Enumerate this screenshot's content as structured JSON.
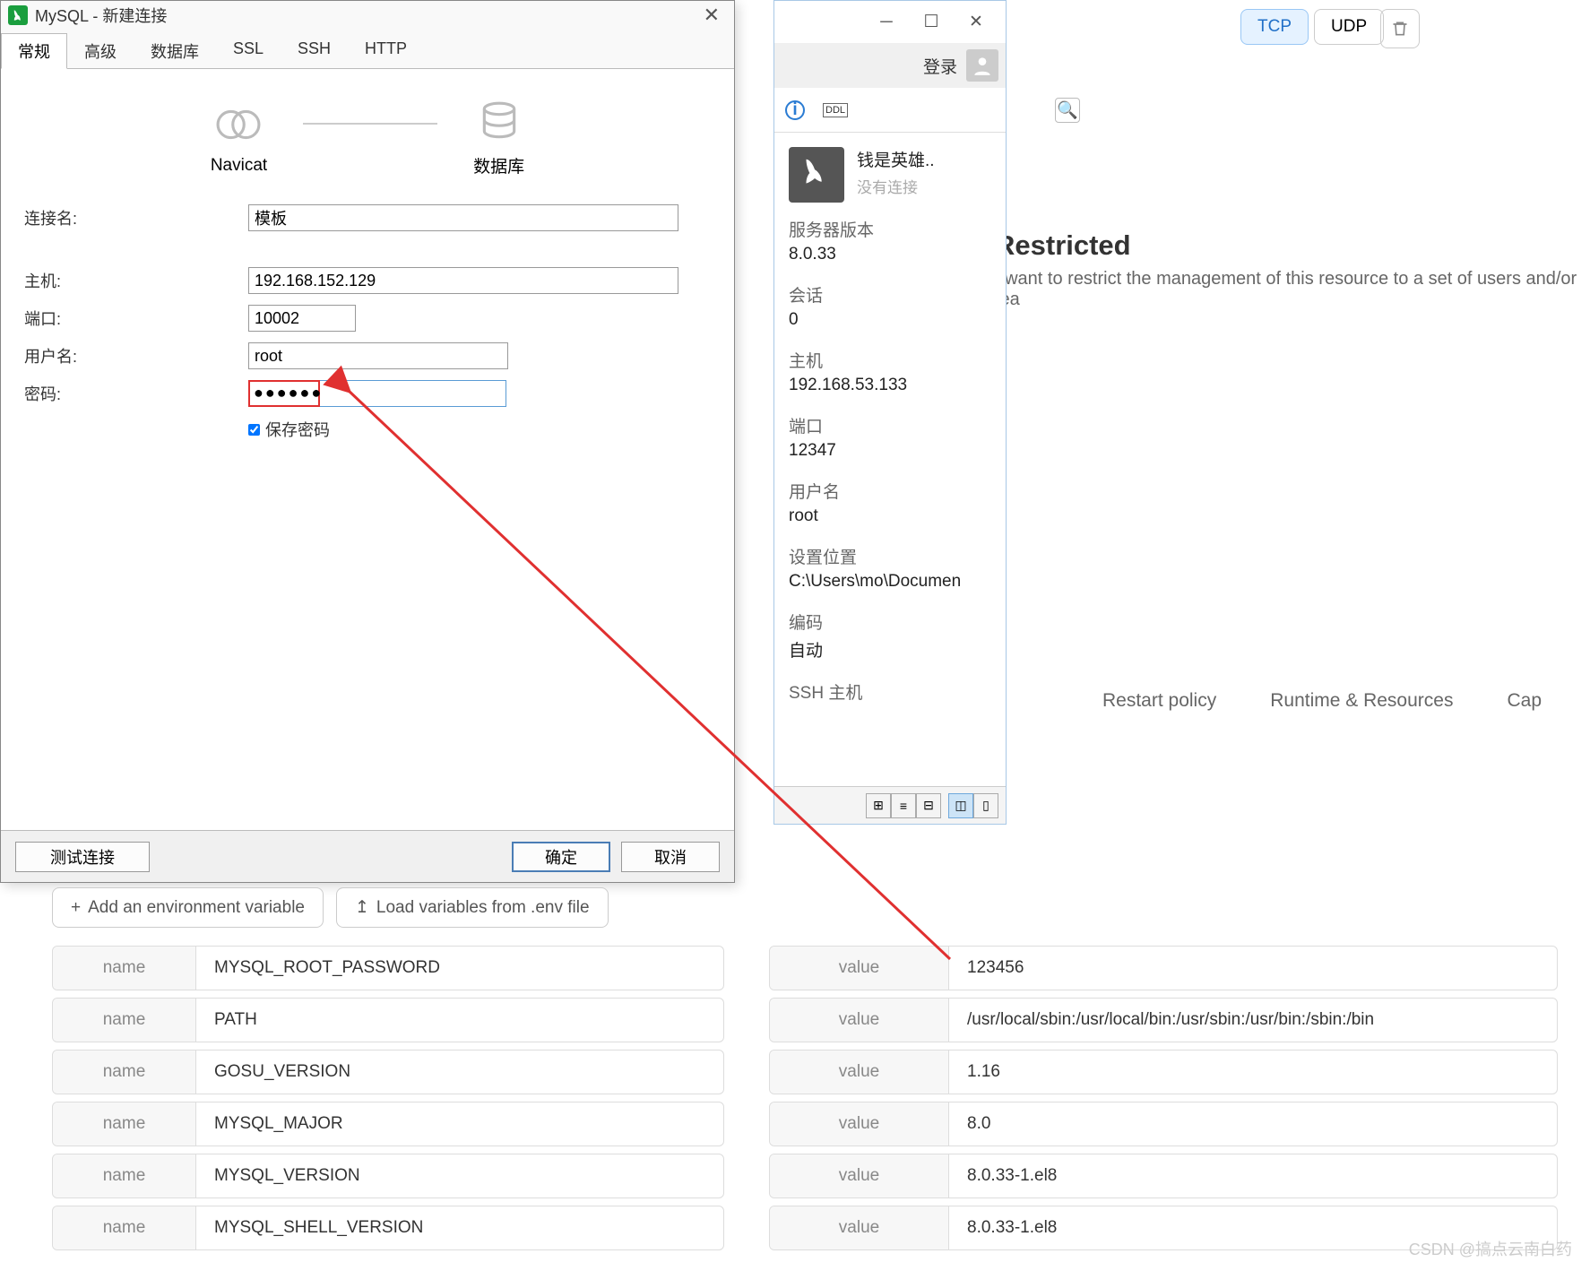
{
  "proto": {
    "tcp": "TCP",
    "udp": "UDP"
  },
  "restricted": {
    "title": "Restricted",
    "desc": "I want to restrict the management of this resource to a set of users and/or tea"
  },
  "docker_tabs": [
    "Restart policy",
    "Runtime & Resources",
    "Cap"
  ],
  "navicat_main": {
    "login": "登录",
    "conn_name": "钱是英雄..",
    "conn_status": "没有连接",
    "sections": {
      "server_ver_l": "服务器版本",
      "server_ver_v": "8.0.33",
      "session_l": "会话",
      "session_v": "0",
      "host_l": "主机",
      "host_v": "192.168.53.133",
      "port_l": "端口",
      "port_v": "12347",
      "user_l": "用户名",
      "user_v": "root",
      "loc_l": "设置位置",
      "loc_v": "C:\\Users\\mo\\Documen",
      "enc_l": "编码",
      "enc_v": "自动",
      "ssh_l": "SSH 主机"
    }
  },
  "dialog": {
    "title": "MySQL - 新建连接",
    "tabs": [
      "常规",
      "高级",
      "数据库",
      "SSL",
      "SSH",
      "HTTP"
    ],
    "node_left": "Navicat",
    "node_right": "数据库",
    "fields": {
      "conn_name_l": "连接名:",
      "conn_name_v": "模板",
      "host_l": "主机:",
      "host_v": "192.168.152.129",
      "port_l": "端口:",
      "port_v": "10002",
      "user_l": "用户名:",
      "user_v": "root",
      "pw_l": "密码:",
      "pw_v": "●●●●●●",
      "save_pw": "保存密码"
    },
    "test_btn": "测试连接",
    "ok_btn": "确定",
    "cancel_btn": "取消"
  },
  "env": {
    "add_btn": "Add an environment variable",
    "load_btn": "Load variables from .env file",
    "name_label": "name",
    "value_label": "value",
    "rows": [
      {
        "n": "MYSQL_ROOT_PASSWORD",
        "v": "123456"
      },
      {
        "n": "PATH",
        "v": "/usr/local/sbin:/usr/local/bin:/usr/sbin:/usr/bin:/sbin:/bin"
      },
      {
        "n": "GOSU_VERSION",
        "v": "1.16"
      },
      {
        "n": "MYSQL_MAJOR",
        "v": "8.0"
      },
      {
        "n": "MYSQL_VERSION",
        "v": "8.0.33-1.el8"
      },
      {
        "n": "MYSQL_SHELL_VERSION",
        "v": "8.0.33-1.el8"
      }
    ]
  },
  "watermark": "CSDN @搞点云南白药"
}
